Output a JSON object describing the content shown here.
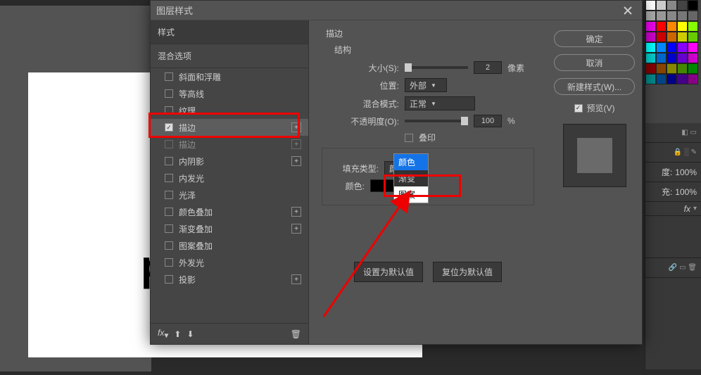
{
  "dialog": {
    "title": "图层样式",
    "styles_header": "样式",
    "blend_options": "混合选项",
    "effects": [
      {
        "label": "斜面和浮雕",
        "checked": false,
        "add": false
      },
      {
        "label": "等高线",
        "checked": false,
        "add": false
      },
      {
        "label": "纹理",
        "checked": false,
        "add": false
      },
      {
        "label": "描边",
        "checked": true,
        "selected": true,
        "add": true
      },
      {
        "label": "描边",
        "checked": false,
        "add": true,
        "disabled": true
      },
      {
        "label": "内阴影",
        "checked": false,
        "add": true
      },
      {
        "label": "内发光",
        "checked": false,
        "add": false
      },
      {
        "label": "光泽",
        "checked": false,
        "add": false
      },
      {
        "label": "颜色叠加",
        "checked": false,
        "add": true
      },
      {
        "label": "渐变叠加",
        "checked": false,
        "add": true
      },
      {
        "label": "图案叠加",
        "checked": false,
        "add": false
      },
      {
        "label": "外发光",
        "checked": false,
        "add": false
      },
      {
        "label": "投影",
        "checked": false,
        "add": true
      }
    ],
    "fx_label": "fx"
  },
  "stroke": {
    "section": "描边",
    "structure": "结构",
    "size_label": "大小(S):",
    "size_value": "2",
    "size_unit": "像素",
    "position_label": "位置:",
    "position_value": "外部",
    "blend_label": "混合模式:",
    "blend_value": "正常",
    "opacity_label": "不透明度(O):",
    "opacity_value": "100",
    "opacity_unit": "%",
    "overprint": "叠印",
    "fill_type_label": "填充类型:",
    "fill_type_value": "颜色",
    "fill_options": [
      "颜色",
      "渐变",
      "图案"
    ],
    "color_label": "颜色:",
    "set_default": "设置为默认值",
    "reset_default": "复位为默认值"
  },
  "buttons": {
    "ok": "确定",
    "cancel": "取消",
    "new_style": "新建样式(W)...",
    "preview": "预览(V)"
  },
  "canvas_text": "pl",
  "side": {
    "pct": "100%"
  },
  "swatch_colors": [
    [
      "#fff",
      "#ccc",
      "#888",
      "#444",
      "#000"
    ],
    [
      "#aaa",
      "#999",
      "#888",
      "#777",
      "#666"
    ],
    [
      "#e0e",
      "#f00",
      "#f80",
      "#ff0",
      "#8f0"
    ],
    [
      "#c0c",
      "#c00",
      "#c60",
      "#cc0",
      "#6c0"
    ],
    [
      "#0ff",
      "#08f",
      "#00f",
      "#80f",
      "#f0f"
    ],
    [
      "#0cc",
      "#06c",
      "#00c",
      "#60c",
      "#c0c"
    ],
    [
      "#800",
      "#840",
      "#880",
      "#480",
      "#080"
    ],
    [
      "#088",
      "#048",
      "#008",
      "#408",
      "#808"
    ]
  ]
}
